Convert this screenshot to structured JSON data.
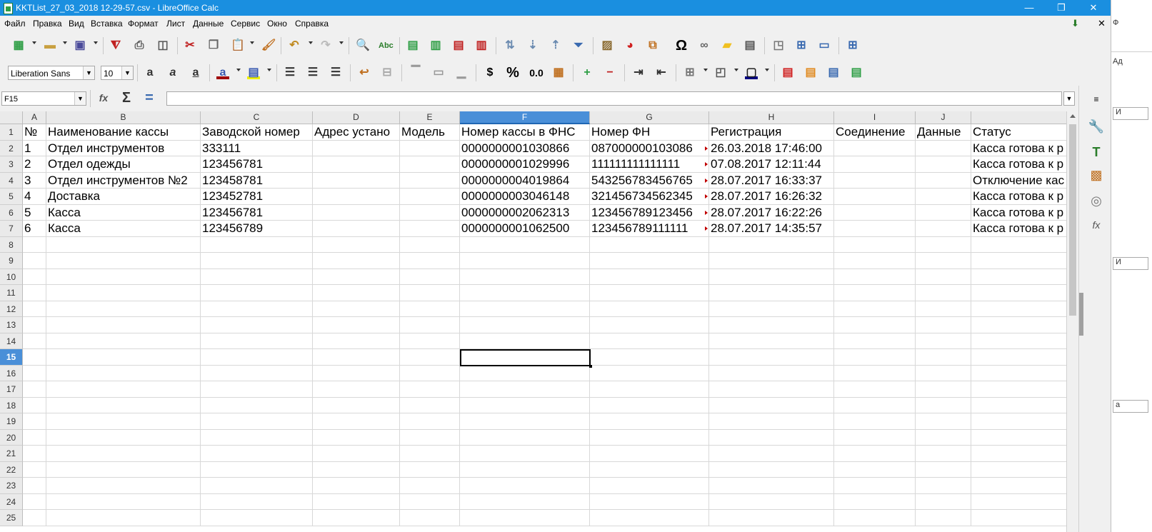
{
  "window": {
    "title": "KKTList_27_03_2018 12-29-57.csv - LibreOffice Calc",
    "minimize": "—",
    "maximize": "❐",
    "close": "✕"
  },
  "menu": {
    "items": [
      "Файл",
      "Правка",
      "Вид",
      "Вставка",
      "Формат",
      "Лист",
      "Данные",
      "Сервис",
      "Окно",
      "Справка"
    ],
    "update_icon": "update-icon",
    "close_doc": "✕"
  },
  "toolbar2": {
    "font_name": "Liberation Sans",
    "font_size": "10",
    "currency": "$",
    "percent": "%",
    "number_format": "0.0"
  },
  "formula": {
    "cell_ref": "F15",
    "content": ""
  },
  "sheet": {
    "columns": [
      "A",
      "B",
      "C",
      "D",
      "E",
      "F",
      "G",
      "H",
      "I",
      "J",
      ""
    ],
    "selected_column": "F",
    "row_numbers": [
      "1",
      "2",
      "3",
      "4",
      "5",
      "6",
      "7",
      "8",
      "9",
      "10",
      "11",
      "12",
      "13",
      "14",
      "15",
      "16",
      "17",
      "18",
      "19",
      "20",
      "21",
      "22",
      "23",
      "24",
      "25"
    ],
    "selected_row": "15",
    "rows": [
      [
        "№",
        "Наименование кассы",
        "Заводской номер",
        "Адрес устано",
        "Модель",
        "Номер кассы в ФНС",
        "Номер ФН",
        "Регистрация",
        "Соединение",
        "Данные",
        "Статус"
      ],
      [
        "1",
        "Отдел инструментов",
        "333111",
        "",
        "",
        "0000000001030866",
        "087000000103086",
        "26.03.2018 17:46:00",
        "",
        "",
        "Касса готова к р"
      ],
      [
        "2",
        "Отдел одежды",
        "123456781",
        "",
        "",
        "0000000001029996",
        "111111111111111",
        "07.08.2017 12:11:44",
        "",
        "",
        "Касса готова к р"
      ],
      [
        "3",
        "Отдел инструментов №2",
        "123458781",
        "",
        "",
        "0000000004019864",
        "543256783456765",
        "28.07.2017 16:33:37",
        "",
        "",
        "Отключение кас"
      ],
      [
        "4",
        "Доставка",
        "123452781",
        "",
        "",
        "0000000003046148",
        "321456734562345",
        "28.07.2017 16:26:32",
        "",
        "",
        "Касса готова к р"
      ],
      [
        "5",
        "Касса",
        "123456781",
        "",
        "",
        "0000000002062313",
        "123456789123456",
        "28.07.2017 16:22:26",
        "",
        "",
        "Касса готова к р"
      ],
      [
        "6",
        "Касса",
        "123456789",
        "",
        "",
        "0000000001062500",
        "123456789111111",
        "28.07.2017 14:35:57",
        "",
        "",
        "Касса готова к р"
      ]
    ]
  },
  "deck_edge": {
    "letters": [
      "Ф",
      "Ад",
      "И",
      "И",
      "а"
    ]
  },
  "colors": {
    "titlebar": "#1a8fe0",
    "selection": "#4a8fd8",
    "overflow_marker": "#c00000"
  }
}
